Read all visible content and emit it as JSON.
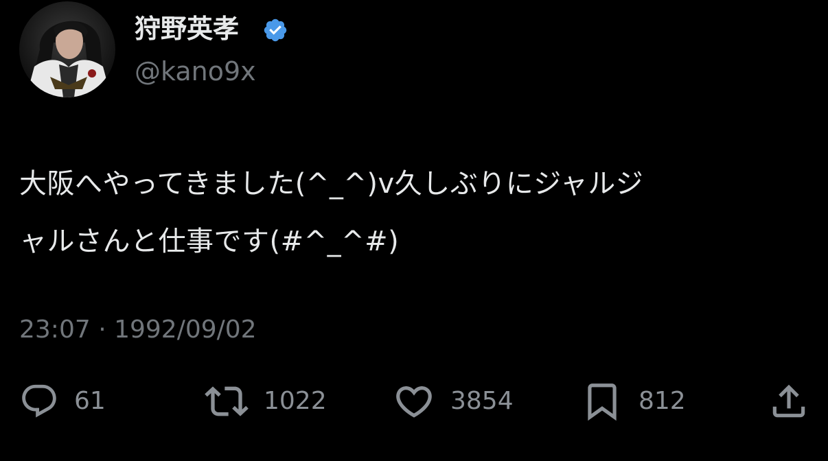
{
  "tweet": {
    "author": {
      "display_name": "狩野英孝",
      "handle": "@kano9x",
      "verified_icon": "verified-badge-icon",
      "verified_color": "#4a99e9"
    },
    "text": "大阪へやってきました(^_^)v久しぶりにジャルジ\nャルさんと仕事です(#^_^#)",
    "timestamp": "23:07 · 1992/09/02",
    "actions": {
      "replies": {
        "icon": "reply-icon",
        "count": "61"
      },
      "retweets": {
        "icon": "retweet-icon",
        "count": "1022"
      },
      "likes": {
        "icon": "heart-icon",
        "count": "3854"
      },
      "bookmarks": {
        "icon": "bookmark-icon",
        "count": "812"
      },
      "share": {
        "icon": "share-icon"
      }
    }
  },
  "colors": {
    "background": "#000000",
    "primary_text": "#e7e9ea",
    "secondary_text": "#71767b",
    "action_icon": "#8b9096"
  }
}
